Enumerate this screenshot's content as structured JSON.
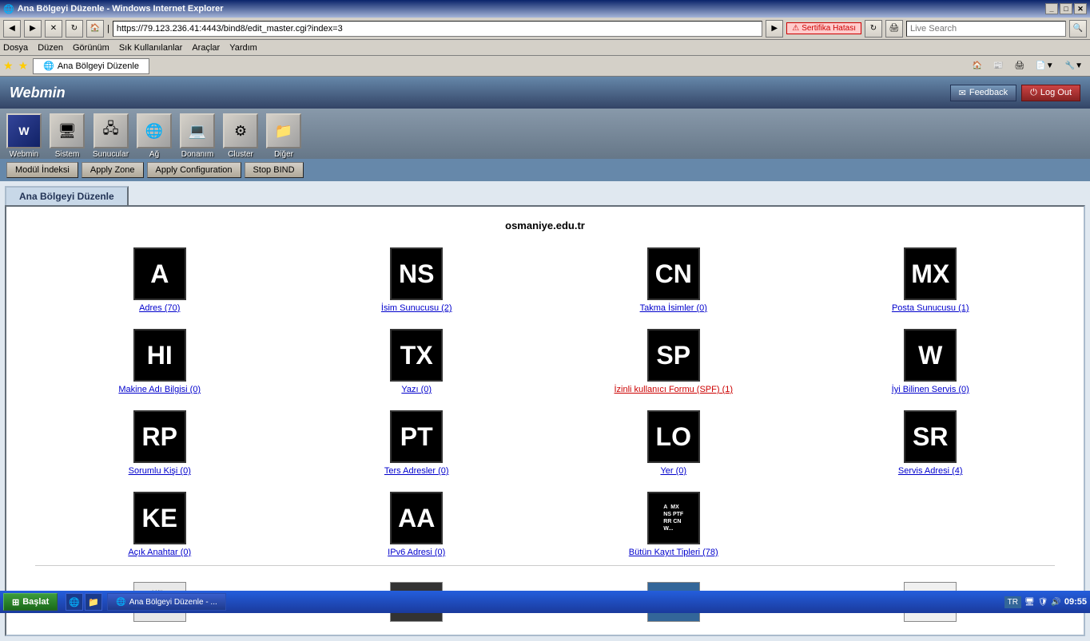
{
  "window": {
    "title": "Ana Bölgeyi Düzenle - Windows Internet Explorer",
    "url": "https://79.123.236.41:4443/bind8/edit_master.cgi?index=3",
    "security_warning": "Sertifika Hatası"
  },
  "menu": {
    "items": [
      "Dosya",
      "Düzen",
      "Görünüm",
      "Sık Kullanılanlar",
      "Araçlar",
      "Yardım"
    ]
  },
  "favorites_tab": "Ana Bölgeyi Düzenle",
  "search": {
    "placeholder": "Live Search",
    "label": "Search"
  },
  "webmin": {
    "logo": "Webmin",
    "feedback_label": "Feedback",
    "logout_label": "Log Out"
  },
  "nav_icons": [
    {
      "label": "Webmin",
      "icon": "W"
    },
    {
      "label": "Sistem",
      "icon": "🖥"
    },
    {
      "label": "Sunucular",
      "icon": "🖧"
    },
    {
      "label": "Ağ",
      "icon": "🌐"
    },
    {
      "label": "Donanım",
      "icon": "💻"
    },
    {
      "label": "Cluster",
      "icon": "⚙"
    },
    {
      "label": "Diğer",
      "icon": "📁"
    }
  ],
  "action_buttons": [
    {
      "label": "Modül İndeksi",
      "id": "modul-indeksi"
    },
    {
      "label": "Apply Zone",
      "id": "apply-zone"
    },
    {
      "label": "Apply Configuration",
      "id": "apply-configuration"
    },
    {
      "label": "Stop BIND",
      "id": "stop-bind"
    }
  ],
  "page_tab": "Ana Bölgeyi Düzenle",
  "domain": "osmaniye.edu.tr",
  "records": [
    {
      "id": "adres",
      "icon_text": "A",
      "label": "Adres (70)"
    },
    {
      "id": "isim-sunucusu",
      "icon_text": "NS",
      "label": "İsim Sunucusu (2)"
    },
    {
      "id": "takma-isimler",
      "icon_text": "CN",
      "label": "Takma İsimler (0)"
    },
    {
      "id": "posta-sunucusu",
      "icon_text": "MX",
      "label": "Posta Sunucusu (1)"
    },
    {
      "id": "makine-adi-bilgisi",
      "icon_text": "HI",
      "label": "Makine Adı Bilgisi (0)"
    },
    {
      "id": "yazi",
      "icon_text": "TX",
      "label": "Yazı (0)"
    },
    {
      "id": "izinli-kullanici",
      "icon_text": "SP",
      "label": "İzinli kullanıcı Formu (SPF) (1)",
      "active": true
    },
    {
      "id": "iyi-bilinen-servis",
      "icon_text": "W",
      "label": "İyi Bilinen Servis (0)"
    },
    {
      "id": "sorumlu-kisi",
      "icon_text": "RP",
      "label": "Sorumlu Kişi (0)"
    },
    {
      "id": "ters-adresler",
      "icon_text": "PT",
      "label": "Ters Adresler (0)"
    },
    {
      "id": "yer",
      "icon_text": "LO",
      "label": "Yer (0)"
    },
    {
      "id": "servis-adresi",
      "icon_text": "SR",
      "label": "Servis Adresi (4)"
    },
    {
      "id": "acik-anahtar",
      "icon_text": "KE",
      "label": "Açık Anahtar (0)"
    },
    {
      "id": "ipv6-adresi",
      "icon_text": "AA",
      "label": "IPv6 Adresi (0)"
    },
    {
      "id": "butun-kayit-tipleri",
      "icon_text": "ALL",
      "label": "Bütün Kayıt Tipleri (78)"
    }
  ],
  "taskbar": {
    "start_label": "Başlat",
    "task_label": "Ana Bölgeyi Düzenle - ...",
    "time": "09:55",
    "language": "TR"
  }
}
